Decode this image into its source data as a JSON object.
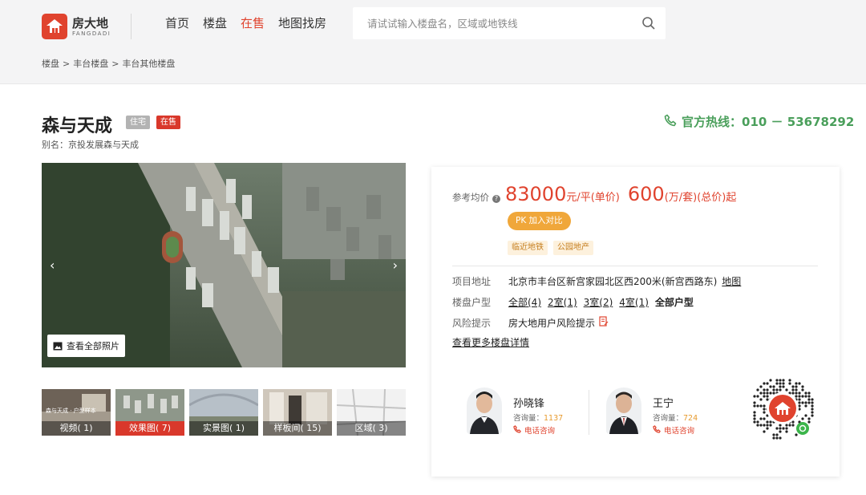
{
  "header": {
    "logo_cn": "房大地",
    "logo_en": "FANGDADI",
    "nav": [
      "首页",
      "楼盘",
      "在售",
      "地图找房"
    ],
    "nav_active_index": 2,
    "search_placeholder": "请试试输入楼盘名，区域或地铁线"
  },
  "breadcrumb": [
    "楼盘",
    "丰台楼盘",
    "丰台其他楼盘"
  ],
  "breadcrumb_sep": ">",
  "project": {
    "name": "森与天成",
    "tag_type": "住宅",
    "tag_status": "在售",
    "alias": "别名：京投发展森与天成"
  },
  "hotline": "官方热线：010 － 53678292",
  "gallery": {
    "arrow_left": "‹",
    "arrow_right": "›",
    "view_all": "查看全部照片",
    "thumbs": [
      "视频( 1)",
      "效果图( 7)",
      "实景图( 1)",
      "样板间( 15)",
      "区域( 3)"
    ],
    "active_thumb": 1,
    "thumb_overlay_text": "森与天成 · 户型样本"
  },
  "price": {
    "label": "参考均价",
    "unit_price": "83000",
    "unit_price_unit": "元/平(单价)",
    "total_price": "600",
    "total_price_unit": "(万/套)(总价)起",
    "pk_button": "PK 加入对比",
    "features": [
      "临近地铁",
      "公园地产"
    ]
  },
  "info": {
    "address_label": "项目地址",
    "address": "北京市丰台区新宫家园北区西200米(新宫西路东)",
    "map_link": "地图",
    "layout_label": "楼盘户型",
    "layouts": [
      "全部(4)",
      "2室(1)",
      "3室(2)",
      "4室(1)"
    ],
    "layouts_all": "全部户型",
    "risk_label": "风险提示",
    "risk_text": "房大地用户风险提示",
    "more_link": "查看更多楼盘详情"
  },
  "agents": [
    {
      "name": "孙晓锋",
      "consult_label": "咨询量：",
      "consult_count": "1137",
      "call": "电话咨询"
    },
    {
      "name": "王宁",
      "consult_label": "咨询量：",
      "consult_count": "724",
      "call": "电话咨询"
    }
  ],
  "colors": {
    "brand_red": "#e0432e",
    "hotline_green": "#4a9f5b",
    "pk_orange": "#f0a73a"
  }
}
